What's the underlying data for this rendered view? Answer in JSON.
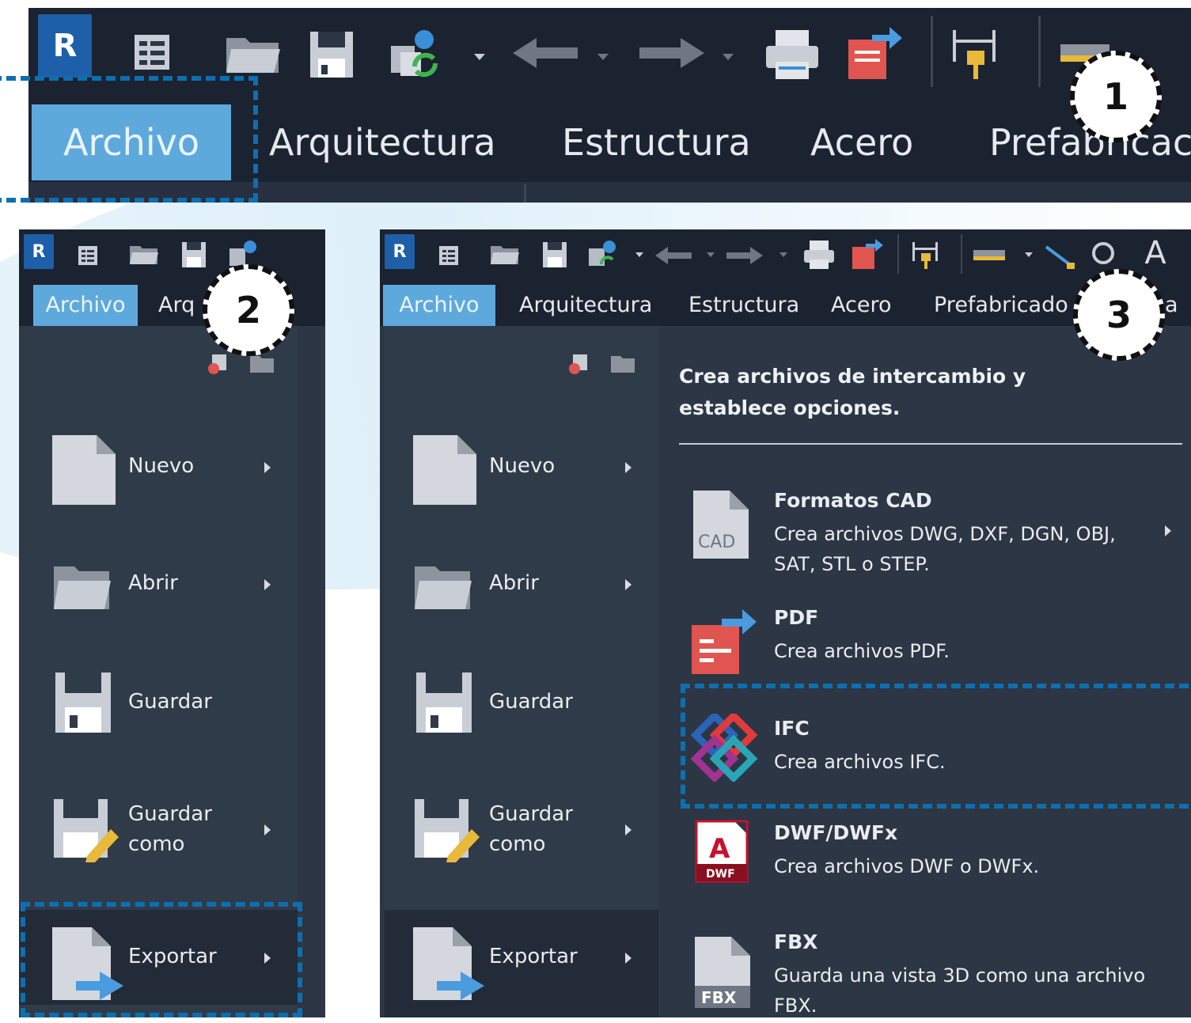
{
  "app": {
    "logo_letter": "R"
  },
  "tabs": [
    "Archivo",
    "Arquitectura",
    "Estructura",
    "Acero",
    "Prefabricado"
  ],
  "panel1": {
    "tabs": [
      "Archivo",
      "Arquitectura",
      "Estructura",
      "Acero",
      "Prefabricac"
    ]
  },
  "panel2": {
    "tabs": [
      "Archivo",
      "Arq"
    ]
  },
  "panel3": {
    "tabs": [
      "Archivo",
      "Arquitectura",
      "Estructura",
      "Acero",
      "Prefabricado",
      "a"
    ]
  },
  "callouts": [
    "1",
    "2",
    "3"
  ],
  "menu": [
    {
      "label": "Nuevo",
      "icon": "new-file-icon",
      "submenu": true
    },
    {
      "label": "Abrir",
      "icon": "open-folder-icon",
      "submenu": true
    },
    {
      "label": "Guardar",
      "icon": "save-icon",
      "submenu": false
    },
    {
      "label": "Guardar\ncomo",
      "line1": "Guardar",
      "line2": "como",
      "icon": "save-as-icon",
      "submenu": true
    },
    {
      "label": "Exportar",
      "icon": "export-icon",
      "submenu": true
    }
  ],
  "export_submenu": {
    "header": "Crea archivos de intercambio y establece opciones.",
    "items": [
      {
        "title": "Formatos CAD",
        "desc": "Crea archivos DWG, DXF, DGN, OBJ, SAT, STL o STEP.",
        "icon": "cad-file-icon",
        "icon_text": "CAD",
        "submenu": true
      },
      {
        "title": "PDF",
        "desc": "Crea archivos PDF.",
        "icon": "pdf-export-icon"
      },
      {
        "title": "IFC",
        "desc": "Crea archivos IFC.",
        "icon": "ifc-logo-icon"
      },
      {
        "title": "DWF/DWFx",
        "desc": "Crea archivos DWF o DWFx.",
        "icon": "dwf-file-icon",
        "icon_text": "DWF",
        "icon_letter": "A"
      },
      {
        "title": "FBX",
        "desc": "Guarda una vista 3D como una archivo FBX.",
        "icon": "fbx-file-icon",
        "icon_text": "FBX"
      }
    ]
  },
  "colors": {
    "accent_tab": "#5ea9dc",
    "dash": "#0d6fb0",
    "panel_bg": "#2c3644",
    "titlebar": "#1b2330"
  }
}
